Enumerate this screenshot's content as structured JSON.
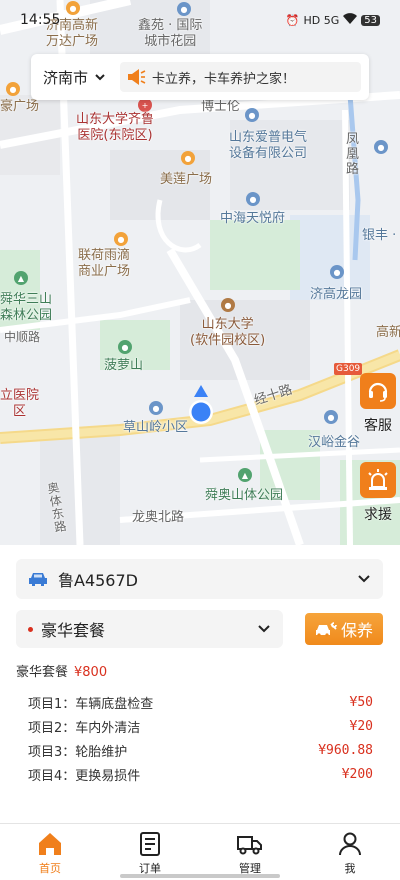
{
  "statusbar": {
    "time": "14:55",
    "network": "HD 5G",
    "battery": "53"
  },
  "topbar": {
    "city": "济南市",
    "notice": "卡立养，卡车养护之家！"
  },
  "map": {
    "labels": [
      {
        "text": "济南高新\n万达广场"
      },
      {
        "text": "鑫苑 · 国际\n城市花园"
      },
      {
        "text": "豪广场"
      },
      {
        "text": "博士伦"
      },
      {
        "text": "山东大学齐鲁\n医院(东院区)"
      },
      {
        "text": "山东爱普电气\n设备有限公司"
      },
      {
        "text": "凤\n凰\n路"
      },
      {
        "text": "美莲广场"
      },
      {
        "text": "中海天悦府"
      },
      {
        "text": "银丰 ·"
      },
      {
        "text": "联荷雨滴\n商业广场"
      },
      {
        "text": "济高龙园"
      },
      {
        "text": "舜华三山\n森林公园"
      },
      {
        "text": "山东大学\n(软件园校区)"
      },
      {
        "text": "高新"
      },
      {
        "text": "中顺路"
      },
      {
        "text": "菠萝山"
      },
      {
        "text": "G309"
      },
      {
        "text": "立医院\n区"
      },
      {
        "text": "经十路"
      },
      {
        "text": "草山岭小区"
      },
      {
        "text": "汉峪金谷"
      },
      {
        "text": "奥\n体\n东\n路"
      },
      {
        "text": "舜奥山体公园"
      },
      {
        "text": "龙奥北路"
      }
    ]
  },
  "side": {
    "service_label": "客服",
    "rescue_label": "求援"
  },
  "panel": {
    "plate": "鲁A4567D",
    "package_name": "豪华套餐",
    "maint_label": "保养",
    "summary_name": "豪华套餐",
    "summary_price": "¥800",
    "items": [
      {
        "label": "项目1：车辆底盘检查",
        "value": "¥50"
      },
      {
        "label": "项目2：车内外清洁",
        "value": "¥20"
      },
      {
        "label": "项目3：轮胎维护",
        "value": "¥960.88"
      },
      {
        "label": "项目4：更换易损件",
        "value": "¥200"
      }
    ]
  },
  "tabs": [
    {
      "label": "首页",
      "icon": "home-icon",
      "active": true
    },
    {
      "label": "订单",
      "icon": "order-icon",
      "active": false
    },
    {
      "label": "管理",
      "icon": "truck-icon",
      "active": false
    },
    {
      "label": "我",
      "icon": "user-icon",
      "active": false
    }
  ],
  "colors": {
    "accent": "#f07f1b",
    "price": "#d9301e",
    "location": "#3b82f6"
  }
}
